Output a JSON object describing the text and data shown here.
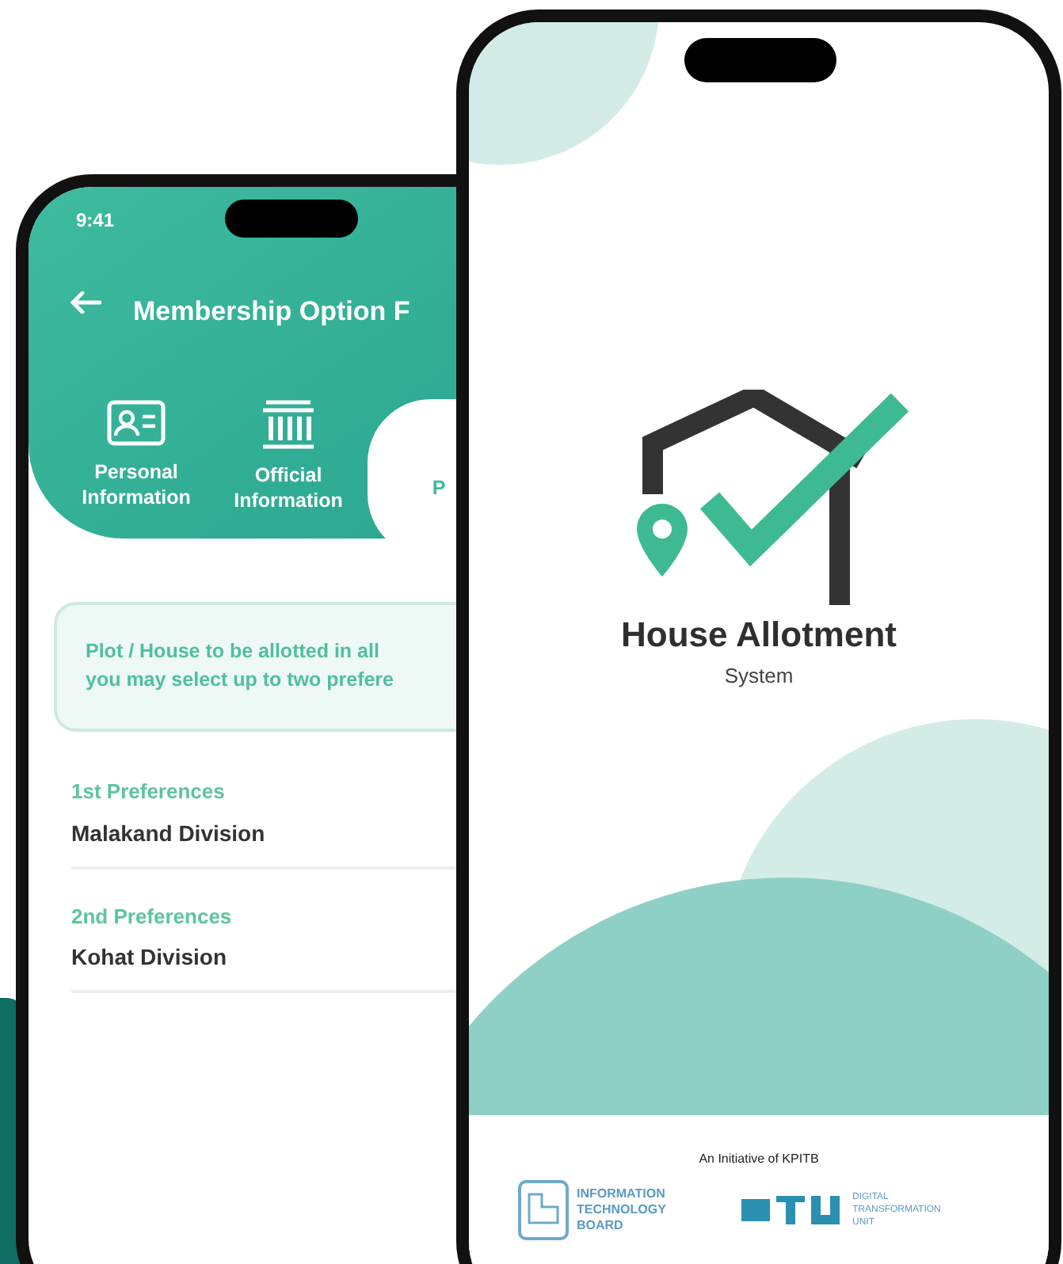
{
  "form_phone": {
    "status_time": "9:41",
    "title": "Membership Option F",
    "tabs": [
      {
        "label": "Personal Information",
        "kind": "id-card",
        "selected": false
      },
      {
        "label": "Official Information",
        "kind": "building",
        "selected": false
      },
      {
        "label": "P",
        "kind": "none",
        "selected": true
      }
    ],
    "notice_lines": [
      "Plot / House to be allotted in all",
      "you may select up to two prefere"
    ],
    "preferences": [
      {
        "label": "1st Preferences",
        "value": "Malakand Division"
      },
      {
        "label": "2nd Preferences",
        "value": "Kohat Division"
      }
    ]
  },
  "splash_phone": {
    "app_name": "House Allotment",
    "app_subtitle": "System",
    "initiative": "An Initiative of KPITB",
    "partners": [
      {
        "kind": "board",
        "name": "INFORMATION TECHNOLOGY BOARD"
      },
      {
        "kind": "unit",
        "name": "DIGITAL TRANSFORMATION UNIT"
      }
    ]
  }
}
